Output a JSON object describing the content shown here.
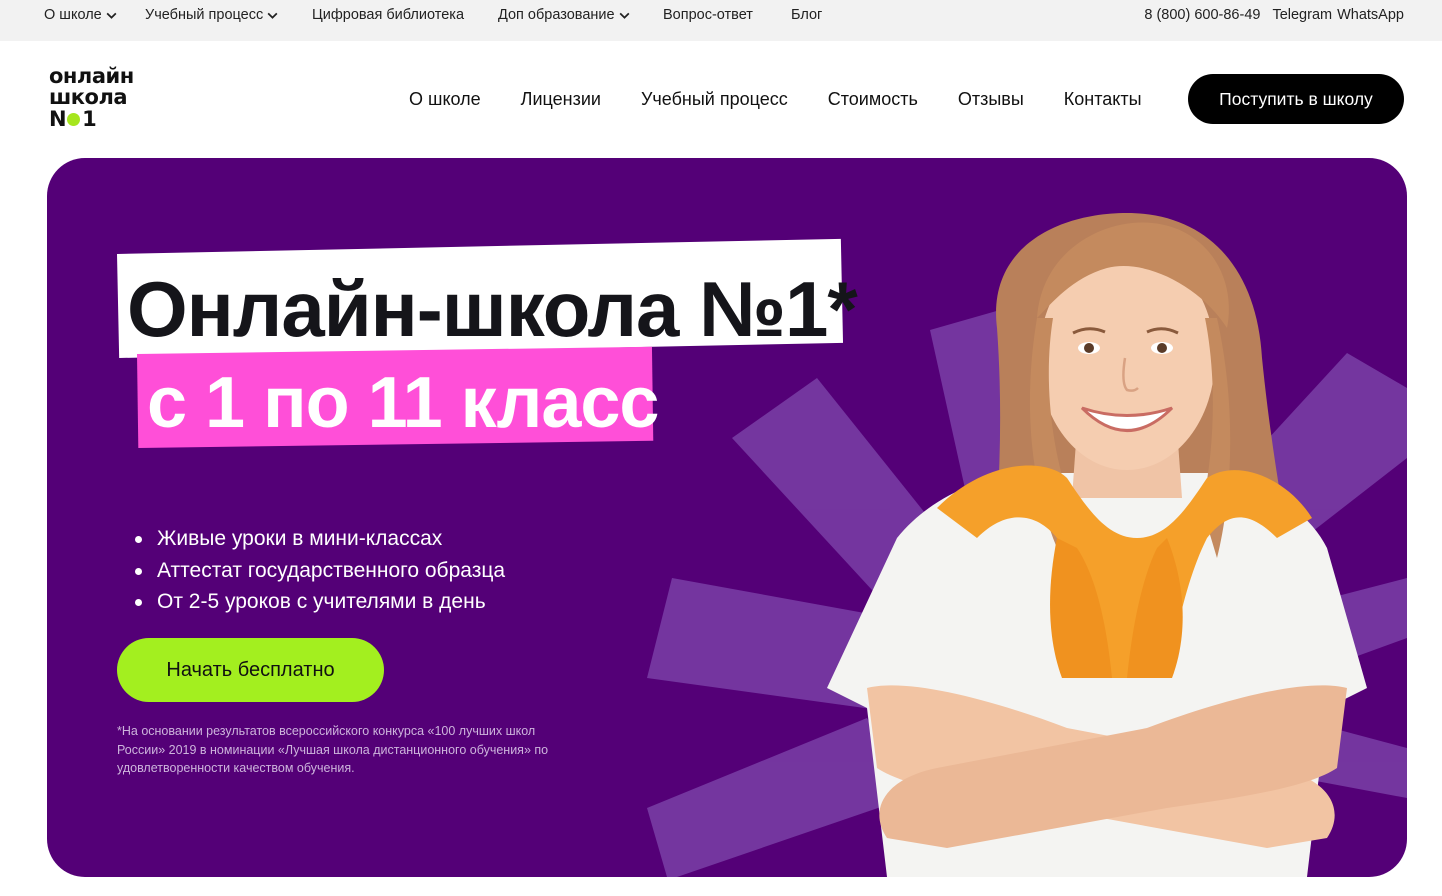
{
  "topbar": {
    "links": [
      {
        "label": "О школе",
        "dropdown": true
      },
      {
        "label": "Учебный процесс",
        "dropdown": true
      },
      {
        "label": "Цифровая библиотека",
        "dropdown": false
      },
      {
        "label": "Доп образование",
        "dropdown": true
      },
      {
        "label": "Вопрос-ответ",
        "dropdown": false
      },
      {
        "label": "Блог",
        "dropdown": false
      }
    ],
    "phone": "8 (800) 600-86-49",
    "telegram": "Telegram",
    "whatsapp": "WhatsApp"
  },
  "header": {
    "logo": {
      "line1": "онлайн",
      "line2": "школа",
      "line3_prefix": "N",
      "line3_suffix": "1"
    },
    "nav": [
      "О школе",
      "Лицензии",
      "Учебный процесс",
      "Стоимость",
      "Отзывы",
      "Контакты"
    ],
    "cta_label": "Поступить в школу"
  },
  "hero": {
    "title_line1": "Онлайн-школа №1*",
    "title_line2": "с 1 по 11 класс",
    "bullets": [
      "Живые уроки в мини-классах",
      "Аттестат государственного образца",
      "От 2-5 уроков с учителями в день"
    ],
    "cta_label": "Начать бесплатно",
    "footnote": "*На основании результатов всероссийского конкурса «100 лучших школ России» 2019 в номинации «Лучшая школа дистанционного обучения» по удовлетворенности качеством обучения."
  },
  "colors": {
    "topbar_bg": "#f2f2f2",
    "hero_bg": "#540077",
    "title_highlight": "#ff4fd8",
    "accent_green": "#a3ef1f",
    "logo_dot": "#a6e61e",
    "cta_dark": "#000000"
  },
  "icons": {
    "dropdown": "chevron-down-icon",
    "hero_image": "student-photo"
  }
}
